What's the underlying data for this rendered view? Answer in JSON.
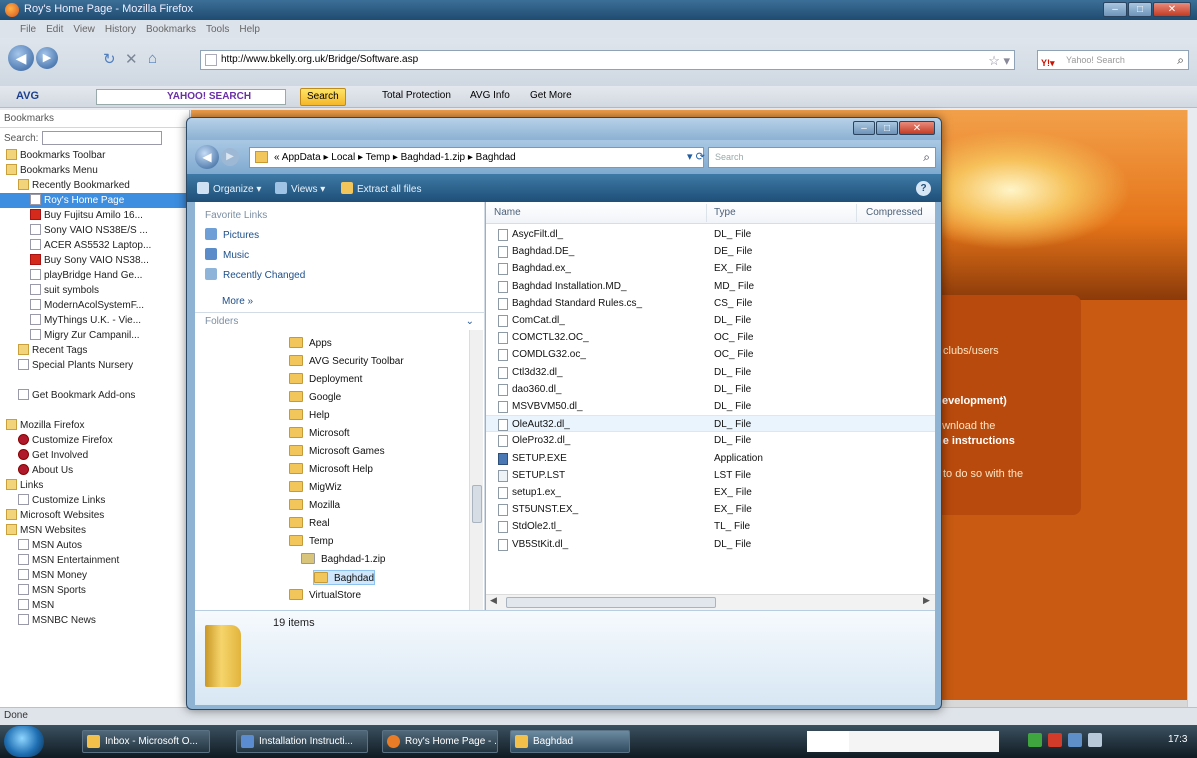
{
  "firefox": {
    "title": "Roy's Home Page - Mozilla Firefox",
    "menu": [
      "File",
      "Edit",
      "View",
      "History",
      "Bookmarks",
      "Tools",
      "Help"
    ],
    "url": "http://www.bkelly.org.uk/Bridge/Software.asp",
    "search_placeholder": "Yahoo! Search",
    "avg": {
      "logo": "AVG",
      "search_brand": "YAHOO! SEARCH",
      "search_button": "Search",
      "total_protection": "Total Protection",
      "avg_info": "AVG Info",
      "get_more": "Get More"
    },
    "status": "Done"
  },
  "sidebar": {
    "title": "Bookmarks",
    "search_label": "Search:",
    "items": [
      {
        "label": "Bookmarks Toolbar",
        "indent": 0,
        "icon": "folder"
      },
      {
        "label": "Bookmarks Menu",
        "indent": 0,
        "icon": "folder"
      },
      {
        "label": "Recently Bookmarked",
        "indent": 1,
        "icon": "folder"
      },
      {
        "label": "Roy's Home Page",
        "indent": 2,
        "icon": "page",
        "selected": true
      },
      {
        "label": "Buy Fujitsu Amilo 16...",
        "indent": 2,
        "icon": "red"
      },
      {
        "label": "Sony VAIO NS38E/S ...",
        "indent": 2,
        "icon": "page"
      },
      {
        "label": "ACER AS5532 Laptop...",
        "indent": 2,
        "icon": "page"
      },
      {
        "label": "Buy Sony VAIO NS38...",
        "indent": 2,
        "icon": "red"
      },
      {
        "label": "playBridge Hand Ge...",
        "indent": 2,
        "icon": "page"
      },
      {
        "label": "suit symbols",
        "indent": 2,
        "icon": "page"
      },
      {
        "label": "ModernAcolSystemF...",
        "indent": 2,
        "icon": "page"
      },
      {
        "label": "MyThings U.K. - Vie...",
        "indent": 2,
        "icon": "page"
      },
      {
        "label": "Migry Zur Campanil...",
        "indent": 2,
        "icon": "page"
      },
      {
        "label": "Recent Tags",
        "indent": 1,
        "icon": "folder"
      },
      {
        "label": "Special Plants Nursery",
        "indent": 1,
        "icon": "page"
      },
      {
        "label": "",
        "indent": 0,
        "icon": "none"
      },
      {
        "label": "Get Bookmark Add-ons",
        "indent": 1,
        "icon": "page"
      },
      {
        "label": "",
        "indent": 0,
        "icon": "none"
      },
      {
        "label": "Mozilla Firefox",
        "indent": 0,
        "icon": "folder"
      },
      {
        "label": "Customize Firefox",
        "indent": 1,
        "icon": "dot"
      },
      {
        "label": "Get Involved",
        "indent": 1,
        "icon": "dot"
      },
      {
        "label": "About Us",
        "indent": 1,
        "icon": "dot"
      },
      {
        "label": "Links",
        "indent": 0,
        "icon": "folder"
      },
      {
        "label": "Customize Links",
        "indent": 1,
        "icon": "page"
      },
      {
        "label": "Microsoft Websites",
        "indent": 0,
        "icon": "folder"
      },
      {
        "label": "MSN Websites",
        "indent": 0,
        "icon": "folder"
      },
      {
        "label": "MSN Autos",
        "indent": 1,
        "icon": "page"
      },
      {
        "label": "MSN Entertainment",
        "indent": 1,
        "icon": "page"
      },
      {
        "label": "MSN Money",
        "indent": 1,
        "icon": "page"
      },
      {
        "label": "MSN Sports",
        "indent": 1,
        "icon": "page"
      },
      {
        "label": "MSN",
        "indent": 1,
        "icon": "page"
      },
      {
        "label": "MSNBC News",
        "indent": 1,
        "icon": "page"
      }
    ]
  },
  "page_content": {
    "clubs": "clubs/users",
    "development": "r development)",
    "download": "ownload the",
    "instructions": "he instructions",
    "todo": "to do so with the"
  },
  "explorer": {
    "breadcrumb": "« AppData ▸ Local ▸ Temp ▸ Baghdad-1.zip ▸ Baghdad",
    "search_placeholder": "Search",
    "toolbar": {
      "organize": "Organize ▾",
      "views": "Views ▾",
      "extract": "Extract all files"
    },
    "favorite_links_title": "Favorite Links",
    "favorite_links": [
      "Pictures",
      "Music",
      "Recently Changed"
    ],
    "more": "More »",
    "folders_title": "Folders",
    "folders": [
      {
        "label": "Apps",
        "level": 0
      },
      {
        "label": "AVG Security Toolbar",
        "level": 0
      },
      {
        "label": "Deployment",
        "level": 0
      },
      {
        "label": "Google",
        "level": 0
      },
      {
        "label": "Help",
        "level": 0
      },
      {
        "label": "Microsoft",
        "level": 0
      },
      {
        "label": "Microsoft Games",
        "level": 0
      },
      {
        "label": "Microsoft Help",
        "level": 0
      },
      {
        "label": "MigWiz",
        "level": 0
      },
      {
        "label": "Mozilla",
        "level": 0
      },
      {
        "label": "Real",
        "level": 0
      },
      {
        "label": "Temp",
        "level": 0
      },
      {
        "label": "Baghdad-1.zip",
        "level": 1
      },
      {
        "label": "Baghdad",
        "level": 2,
        "selected": true
      },
      {
        "label": "VirtualStore",
        "level": 0
      }
    ],
    "columns": [
      "Name",
      "Type",
      "Compressed"
    ],
    "files": [
      {
        "name": "AsycFilt.dl_",
        "type": "DL_ File"
      },
      {
        "name": "Baghdad.DE_",
        "type": "DE_ File"
      },
      {
        "name": "Baghdad.ex_",
        "type": "EX_ File"
      },
      {
        "name": "Baghdad Installation.MD_",
        "type": "MD_ File"
      },
      {
        "name": "Baghdad Standard Rules.cs_",
        "type": "CS_ File"
      },
      {
        "name": "ComCat.dl_",
        "type": "DL_ File"
      },
      {
        "name": "COMCTL32.OC_",
        "type": "OC_ File"
      },
      {
        "name": "COMDLG32.oc_",
        "type": "OC_ File"
      },
      {
        "name": "Ctl3d32.dl_",
        "type": "DL_ File"
      },
      {
        "name": "dao360.dl_",
        "type": "DL_ File"
      },
      {
        "name": "MSVBVM50.dl_",
        "type": "DL_ File"
      },
      {
        "name": "OleAut32.dl_",
        "type": "DL_ File"
      },
      {
        "name": "OlePro32.dl_",
        "type": "DL_ File"
      },
      {
        "name": "SETUP.EXE",
        "type": "Application"
      },
      {
        "name": "SETUP.LST",
        "type": "LST File"
      },
      {
        "name": "setup1.ex_",
        "type": "EX_ File"
      },
      {
        "name": "ST5UNST.EX_",
        "type": "EX_ File"
      },
      {
        "name": "StdOle2.tl_",
        "type": "TL_ File"
      },
      {
        "name": "VB5StKit.dl_",
        "type": "DL_ File"
      }
    ],
    "item_count": "19 items"
  },
  "taskbar": {
    "buttons": [
      "Inbox - Microsoft O...",
      "Installation Instructi...",
      "Roy's Home Page - ...",
      "Baghdad"
    ],
    "clock": "17:3"
  }
}
